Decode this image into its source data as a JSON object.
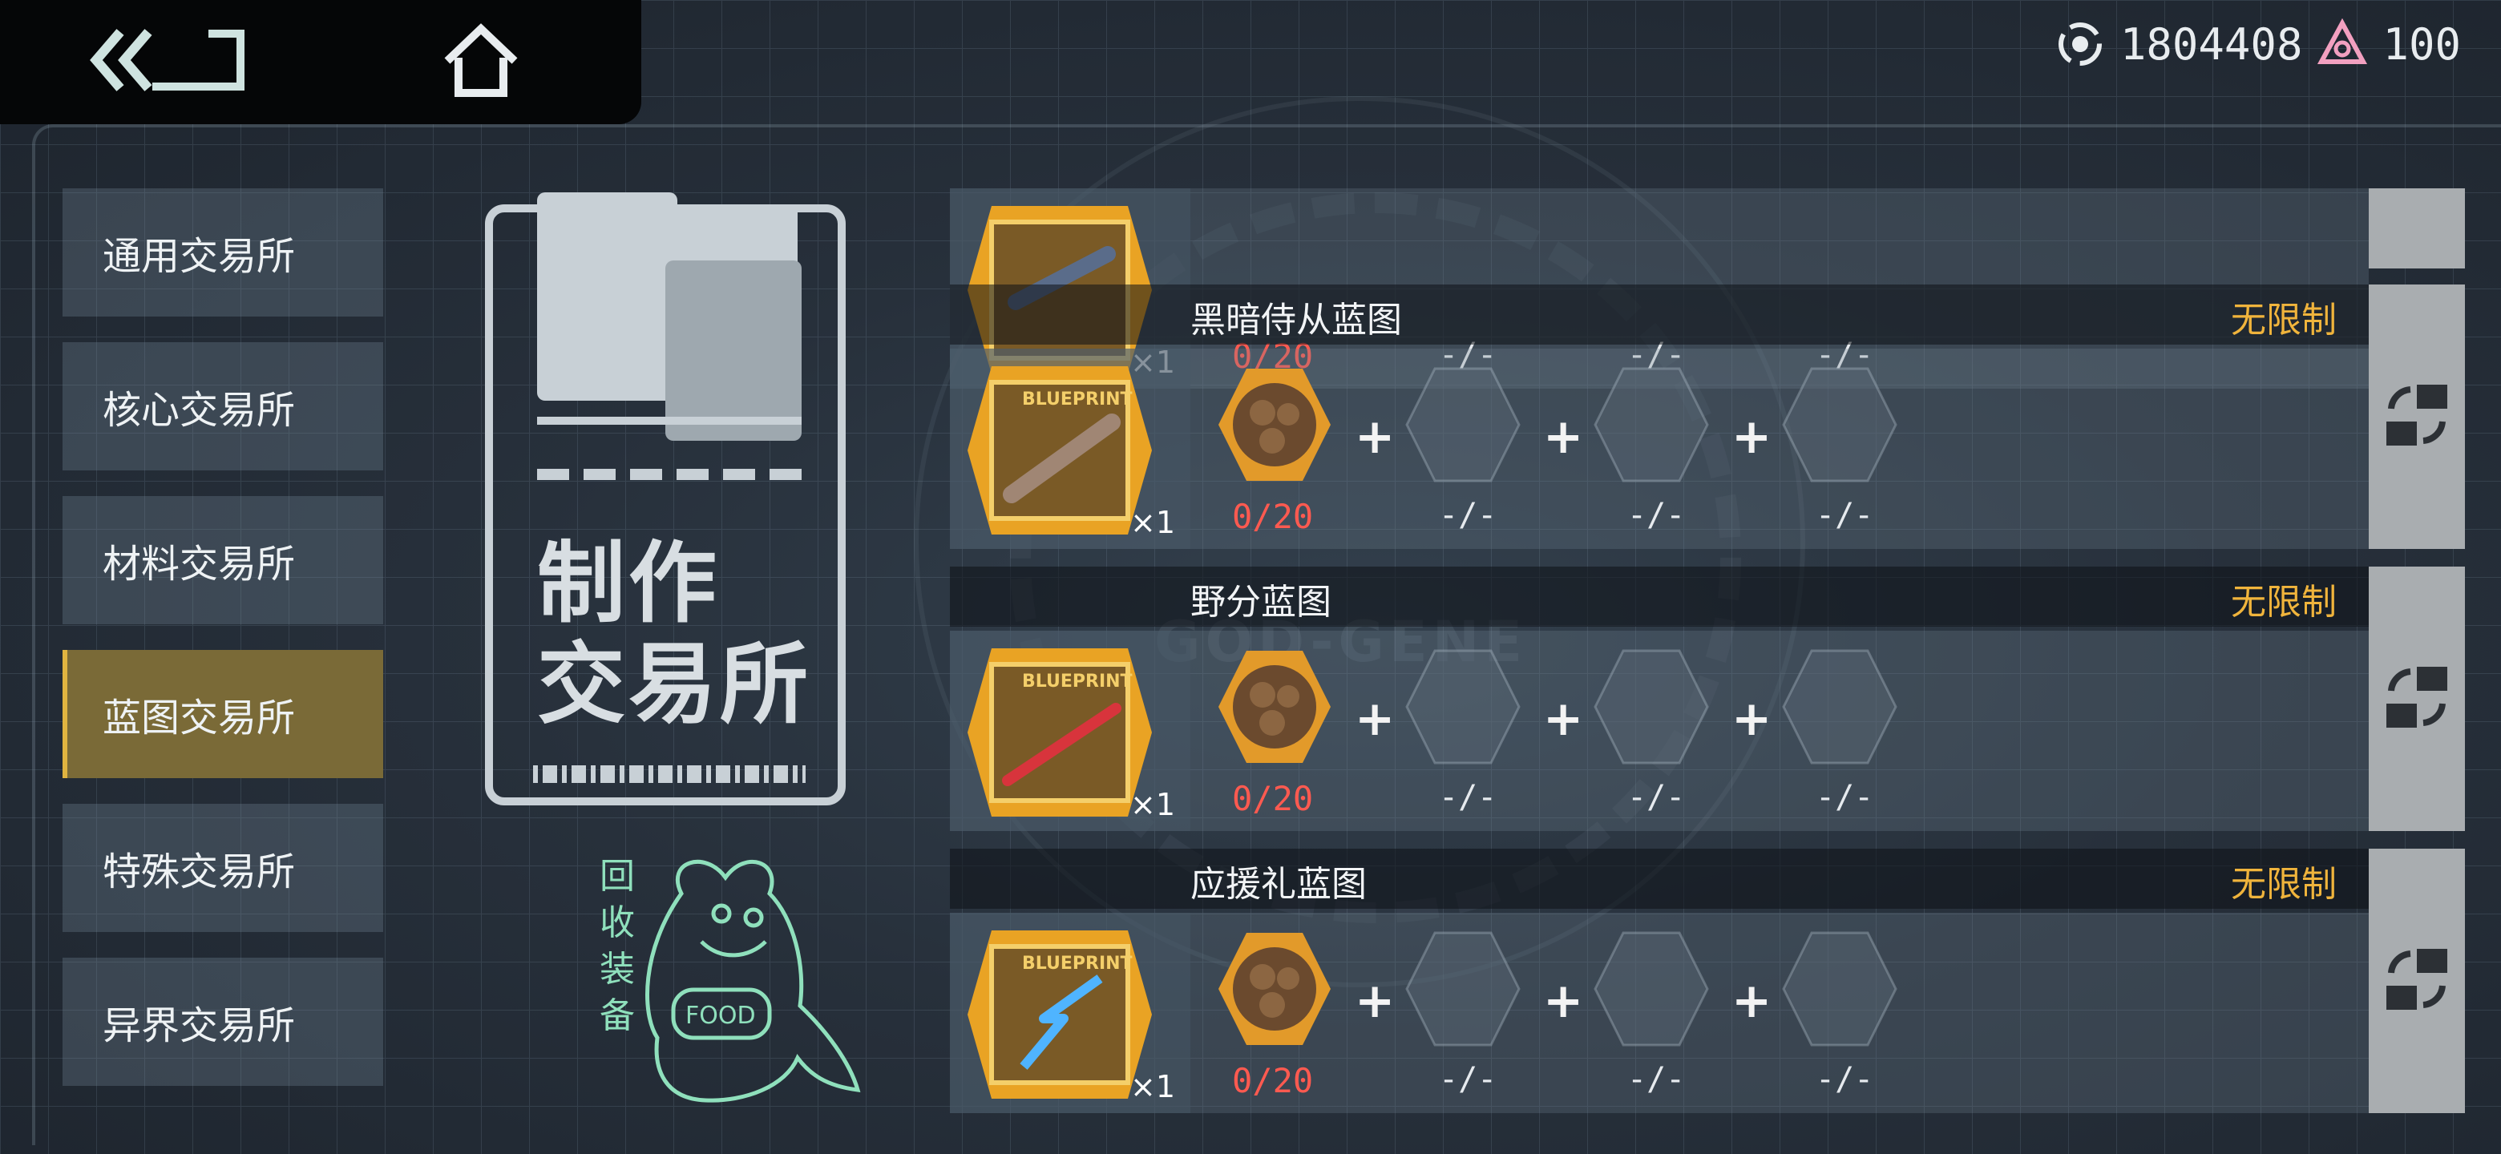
{
  "top_bar": {
    "currency_gold": "1804408",
    "currency_crystal": "100"
  },
  "sidebar": {
    "items": [
      {
        "label": "通用交易所"
      },
      {
        "label": "核心交易所"
      },
      {
        "label": "材料交易所"
      },
      {
        "label": "蓝图交易所"
      },
      {
        "label": "特殊交易所"
      },
      {
        "label": "异界交易所"
      }
    ],
    "active_index": 3
  },
  "card": {
    "title_line1": "制作",
    "title_line2": "交易所"
  },
  "mascot": {
    "label": "回收装备",
    "sign_text": "FOOD"
  },
  "recipes": [
    {
      "name": "",
      "limit": "",
      "qty": "×1",
      "count": "0/20",
      "slots": [
        "-/-",
        "-/-",
        "-/-"
      ],
      "weapon_color": "#5a6c8a"
    },
    {
      "name": "黑暗侍从蓝图",
      "limit": "无限制",
      "qty": "×1",
      "count": "0/20",
      "slots": [
        "-/-",
        "-/-",
        "-/-"
      ],
      "weapon_color": "#a08674"
    },
    {
      "name": "野分蓝图",
      "limit": "无限制",
      "qty": "×1",
      "count": "0/20",
      "slots": [
        "-/-",
        "-/-",
        "-/-"
      ],
      "weapon_color": "#d8343c"
    },
    {
      "name": "应援礼蓝图",
      "limit": "无限制",
      "qty": "×1",
      "count": "0/20",
      "slots": [
        "-/-",
        "-/-",
        "-/-"
      ],
      "weapon_color": "#4fb4ff"
    }
  ],
  "blueprint_text": "BLUEPRINT",
  "colors": {
    "accent_gold": "#f0b43c",
    "count_red": "#ff5a50",
    "active_tab": "#7a6a37"
  }
}
